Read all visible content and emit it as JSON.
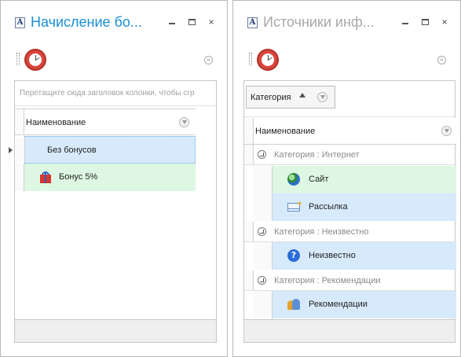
{
  "left_window": {
    "title": "Начисление бо...",
    "group_hint": "Перетащите сюда заголовок колонки, чтобы сгр",
    "column_header": "Наименование",
    "rows": [
      {
        "label": "Без бонусов"
      },
      {
        "label": "Бонус 5%",
        "icon": "gift-icon"
      }
    ]
  },
  "right_window": {
    "title": "Источники инф...",
    "group_chip": "Категория",
    "column_header": "Наименование",
    "groups": [
      {
        "label": "Категория : Интернет",
        "items": [
          {
            "label": "Сайт",
            "icon": "globe-icon"
          },
          {
            "label": "Рассылка",
            "icon": "mail-icon"
          }
        ]
      },
      {
        "label": "Категория : Неизвестно",
        "items": [
          {
            "label": "Неизвестно",
            "icon": "help-icon"
          }
        ]
      },
      {
        "label": "Категория : Рекомендации",
        "items": [
          {
            "label": "Рекомендации",
            "icon": "people-icon"
          }
        ]
      }
    ]
  },
  "window_buttons": {
    "minimize": "minimize-icon",
    "maximize": "maximize-icon",
    "close": "×"
  },
  "colors": {
    "selected_row": "#d7eafb",
    "green_row": "#ddf7e2",
    "active_title": "#1a8fd6",
    "inactive_title": "#a9a9a9"
  }
}
